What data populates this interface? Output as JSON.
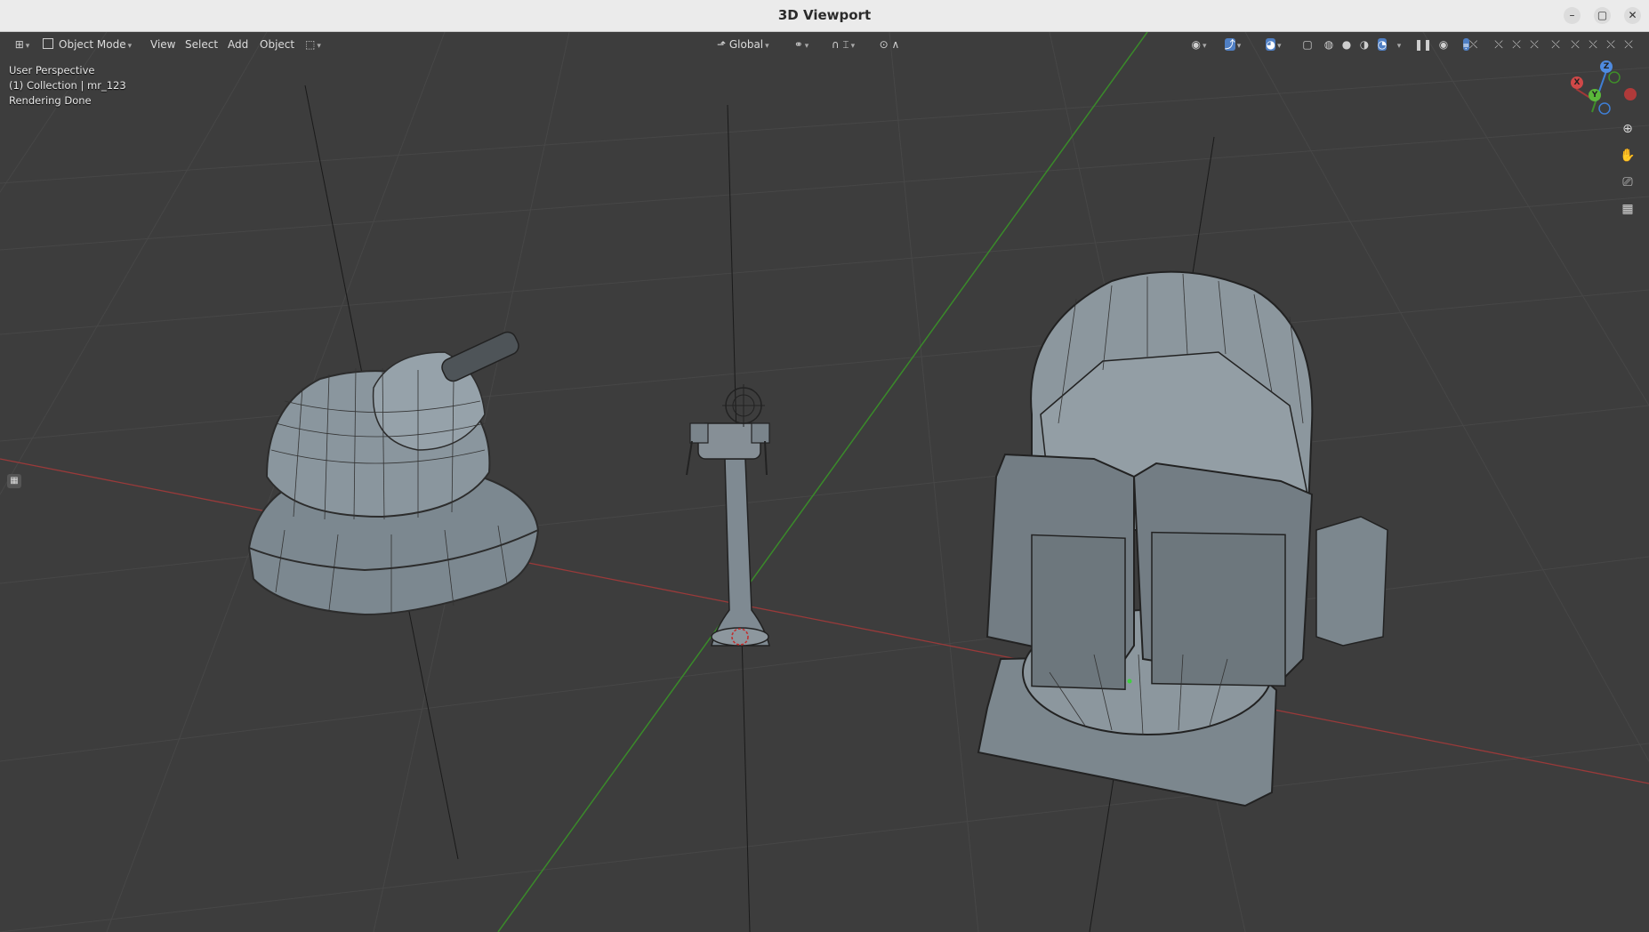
{
  "window": {
    "title": "3D Viewport",
    "minimize": "–",
    "maximize": "▢",
    "close": "✕"
  },
  "header": {
    "editor_type_icon": "viewport-editor-icon",
    "mode_label": "Object Mode",
    "menus": [
      "View",
      "Select",
      "Add",
      "Object"
    ],
    "transform_orientation": "Global"
  },
  "overlay_info": {
    "line1": "User Perspective",
    "line2": "(1) Collection | mr_123",
    "line3": "Rendering Done"
  },
  "gizmo": {
    "x_label": "X",
    "y_label": "Y",
    "z_label": "Z"
  },
  "colors": {
    "x_axis": "#a33838",
    "y_axis": "#3f8f2a",
    "z_axis": "#3f7fd6",
    "grid": "#4a4a4a",
    "background": "#3d3d3d"
  },
  "nav_icons": [
    "zoom-icon",
    "pan-hand-icon",
    "camera-view-icon",
    "ortho-grid-icon"
  ]
}
